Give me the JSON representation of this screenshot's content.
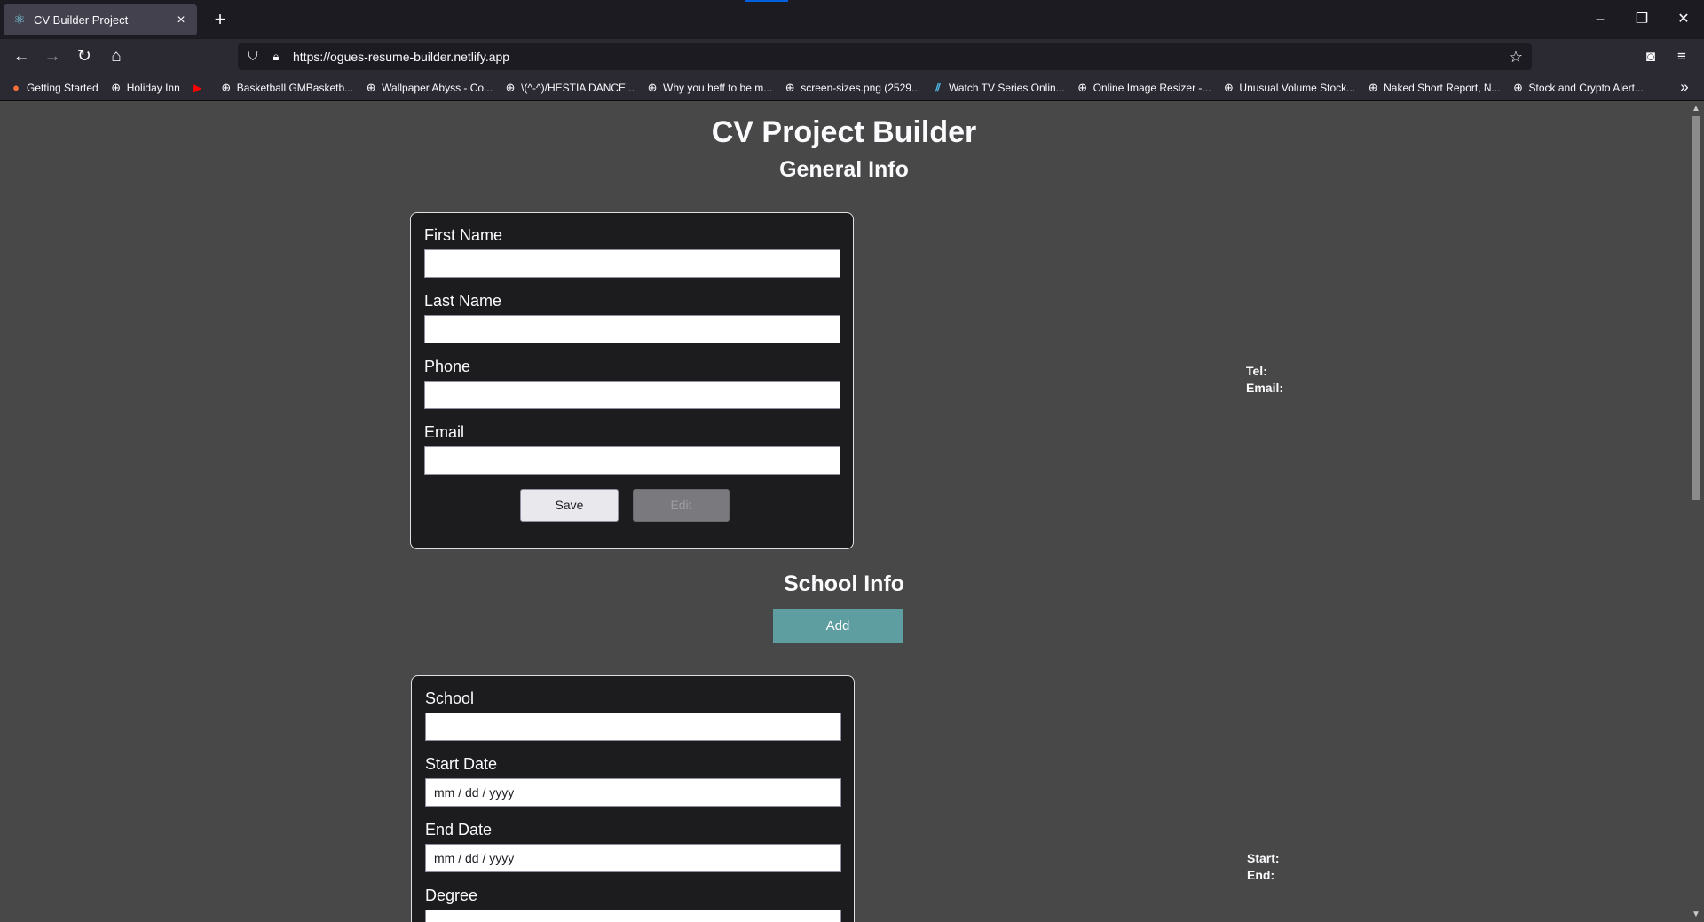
{
  "browser": {
    "tab": {
      "title": "CV Builder Project"
    },
    "url": "https://ogues-resume-builder.netlify.app",
    "bookmarks": [
      {
        "label": "Getting Started",
        "icon": "firefox-icon"
      },
      {
        "label": "Holiday Inn",
        "icon": "globe-icon"
      },
      {
        "label": "",
        "icon": "youtube-icon"
      },
      {
        "label": "Basketball GMBasketb...",
        "icon": "globe-icon"
      },
      {
        "label": "Wallpaper Abyss - Co...",
        "icon": "globe-icon"
      },
      {
        "label": "\\(^-^)/HESTIA DANCE...",
        "icon": "globe-icon"
      },
      {
        "label": "Why you heff to be m...",
        "icon": "globe-icon"
      },
      {
        "label": "screen-sizes.png (2529...",
        "icon": "globe-icon"
      },
      {
        "label": "Watch TV Series Onlin...",
        "icon": "wtv-icon"
      },
      {
        "label": "Online Image Resizer -...",
        "icon": "globe-icon"
      },
      {
        "label": "Unusual Volume Stock...",
        "icon": "globe-icon"
      },
      {
        "label": "Naked Short Report, N...",
        "icon": "globe-icon"
      },
      {
        "label": "Stock and Crypto Alert...",
        "icon": "globe-icon"
      }
    ]
  },
  "page": {
    "title": "CV Project Builder",
    "general": {
      "heading": "General Info",
      "fields": [
        {
          "label": "First Name",
          "value": ""
        },
        {
          "label": "Last Name",
          "value": ""
        },
        {
          "label": "Phone",
          "value": ""
        },
        {
          "label": "Email",
          "value": ""
        }
      ],
      "save_label": "Save",
      "edit_label": "Edit"
    },
    "school": {
      "heading": "School Info",
      "add_label": "Add",
      "fields": [
        {
          "label": "School",
          "value": ""
        },
        {
          "label": "Start Date",
          "value": "mm / dd / yyyy"
        },
        {
          "label": "End Date",
          "value": "mm / dd / yyyy"
        },
        {
          "label": "Degree",
          "value": ""
        }
      ]
    },
    "preview": {
      "tel_label": "Tel:",
      "email_label": "Email:",
      "start_label": "Start:",
      "end_label": "End:"
    }
  }
}
